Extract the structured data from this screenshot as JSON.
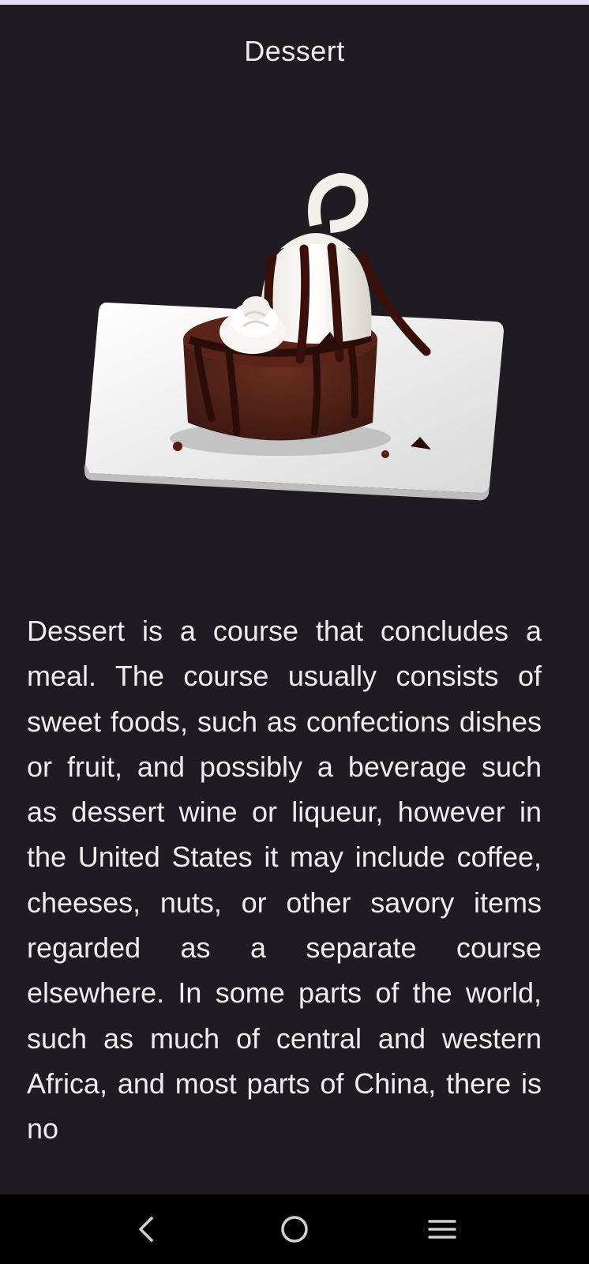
{
  "header": {
    "title": "Dessert"
  },
  "image": {
    "subject": "chocolate brownie dessert with soft serve and fudge on a white plate"
  },
  "article": {
    "text": "Dessert is a course that concludes a meal. The course usually consists of sweet foods, such as confections dishes or fruit, and possibly a beverage such as dessert wine or liqueur, however in the United States it may include coffee, cheeses, nuts, or other savory items regarded as a separate course elsewhere. In some parts of the world, such as much of central and western Africa, and most parts of China, there is no"
  },
  "navbar": {
    "back_icon": "chevron-left-icon",
    "home_icon": "circle-home-icon",
    "recents_icon": "three-lines-recents-icon"
  },
  "colors": {
    "background": "#1e1c22",
    "text": "#eeeeee",
    "accent_bar": "#e7dcf8",
    "navbar": "#000000"
  }
}
